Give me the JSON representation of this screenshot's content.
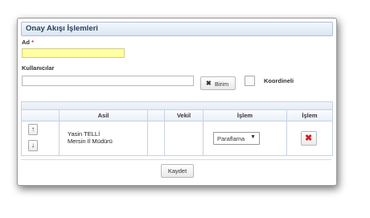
{
  "panel": {
    "title": "Onay Akışı İşlemleri"
  },
  "form": {
    "name_label": "Ad",
    "required_mark": "*",
    "name_value": "",
    "users_label": "Kullanıcılar",
    "users_value": "",
    "unit_button": "Birim",
    "coordinated_label": "Koordineli",
    "coordinated_checked": false
  },
  "table": {
    "columns": [
      "Asil",
      "Vekil",
      "İşlem",
      "İşlem"
    ],
    "rows": [
      {
        "principal_name": "Yasin TELLİ",
        "principal_title": "Mersin İl Müdürü",
        "deputy": "",
        "action": "Paraflama"
      }
    ]
  },
  "footer": {
    "save_button": "Kaydet"
  },
  "icons": {
    "move_up": "arrow-up-icon",
    "move_down": "arrow-down-icon",
    "delete": "delete-x-icon",
    "unit": "close-x-icon"
  },
  "colors": {
    "required_field_bg": "#ffffa2",
    "delete_icon": "#cc2222",
    "title_text": "#2b3f5c"
  }
}
